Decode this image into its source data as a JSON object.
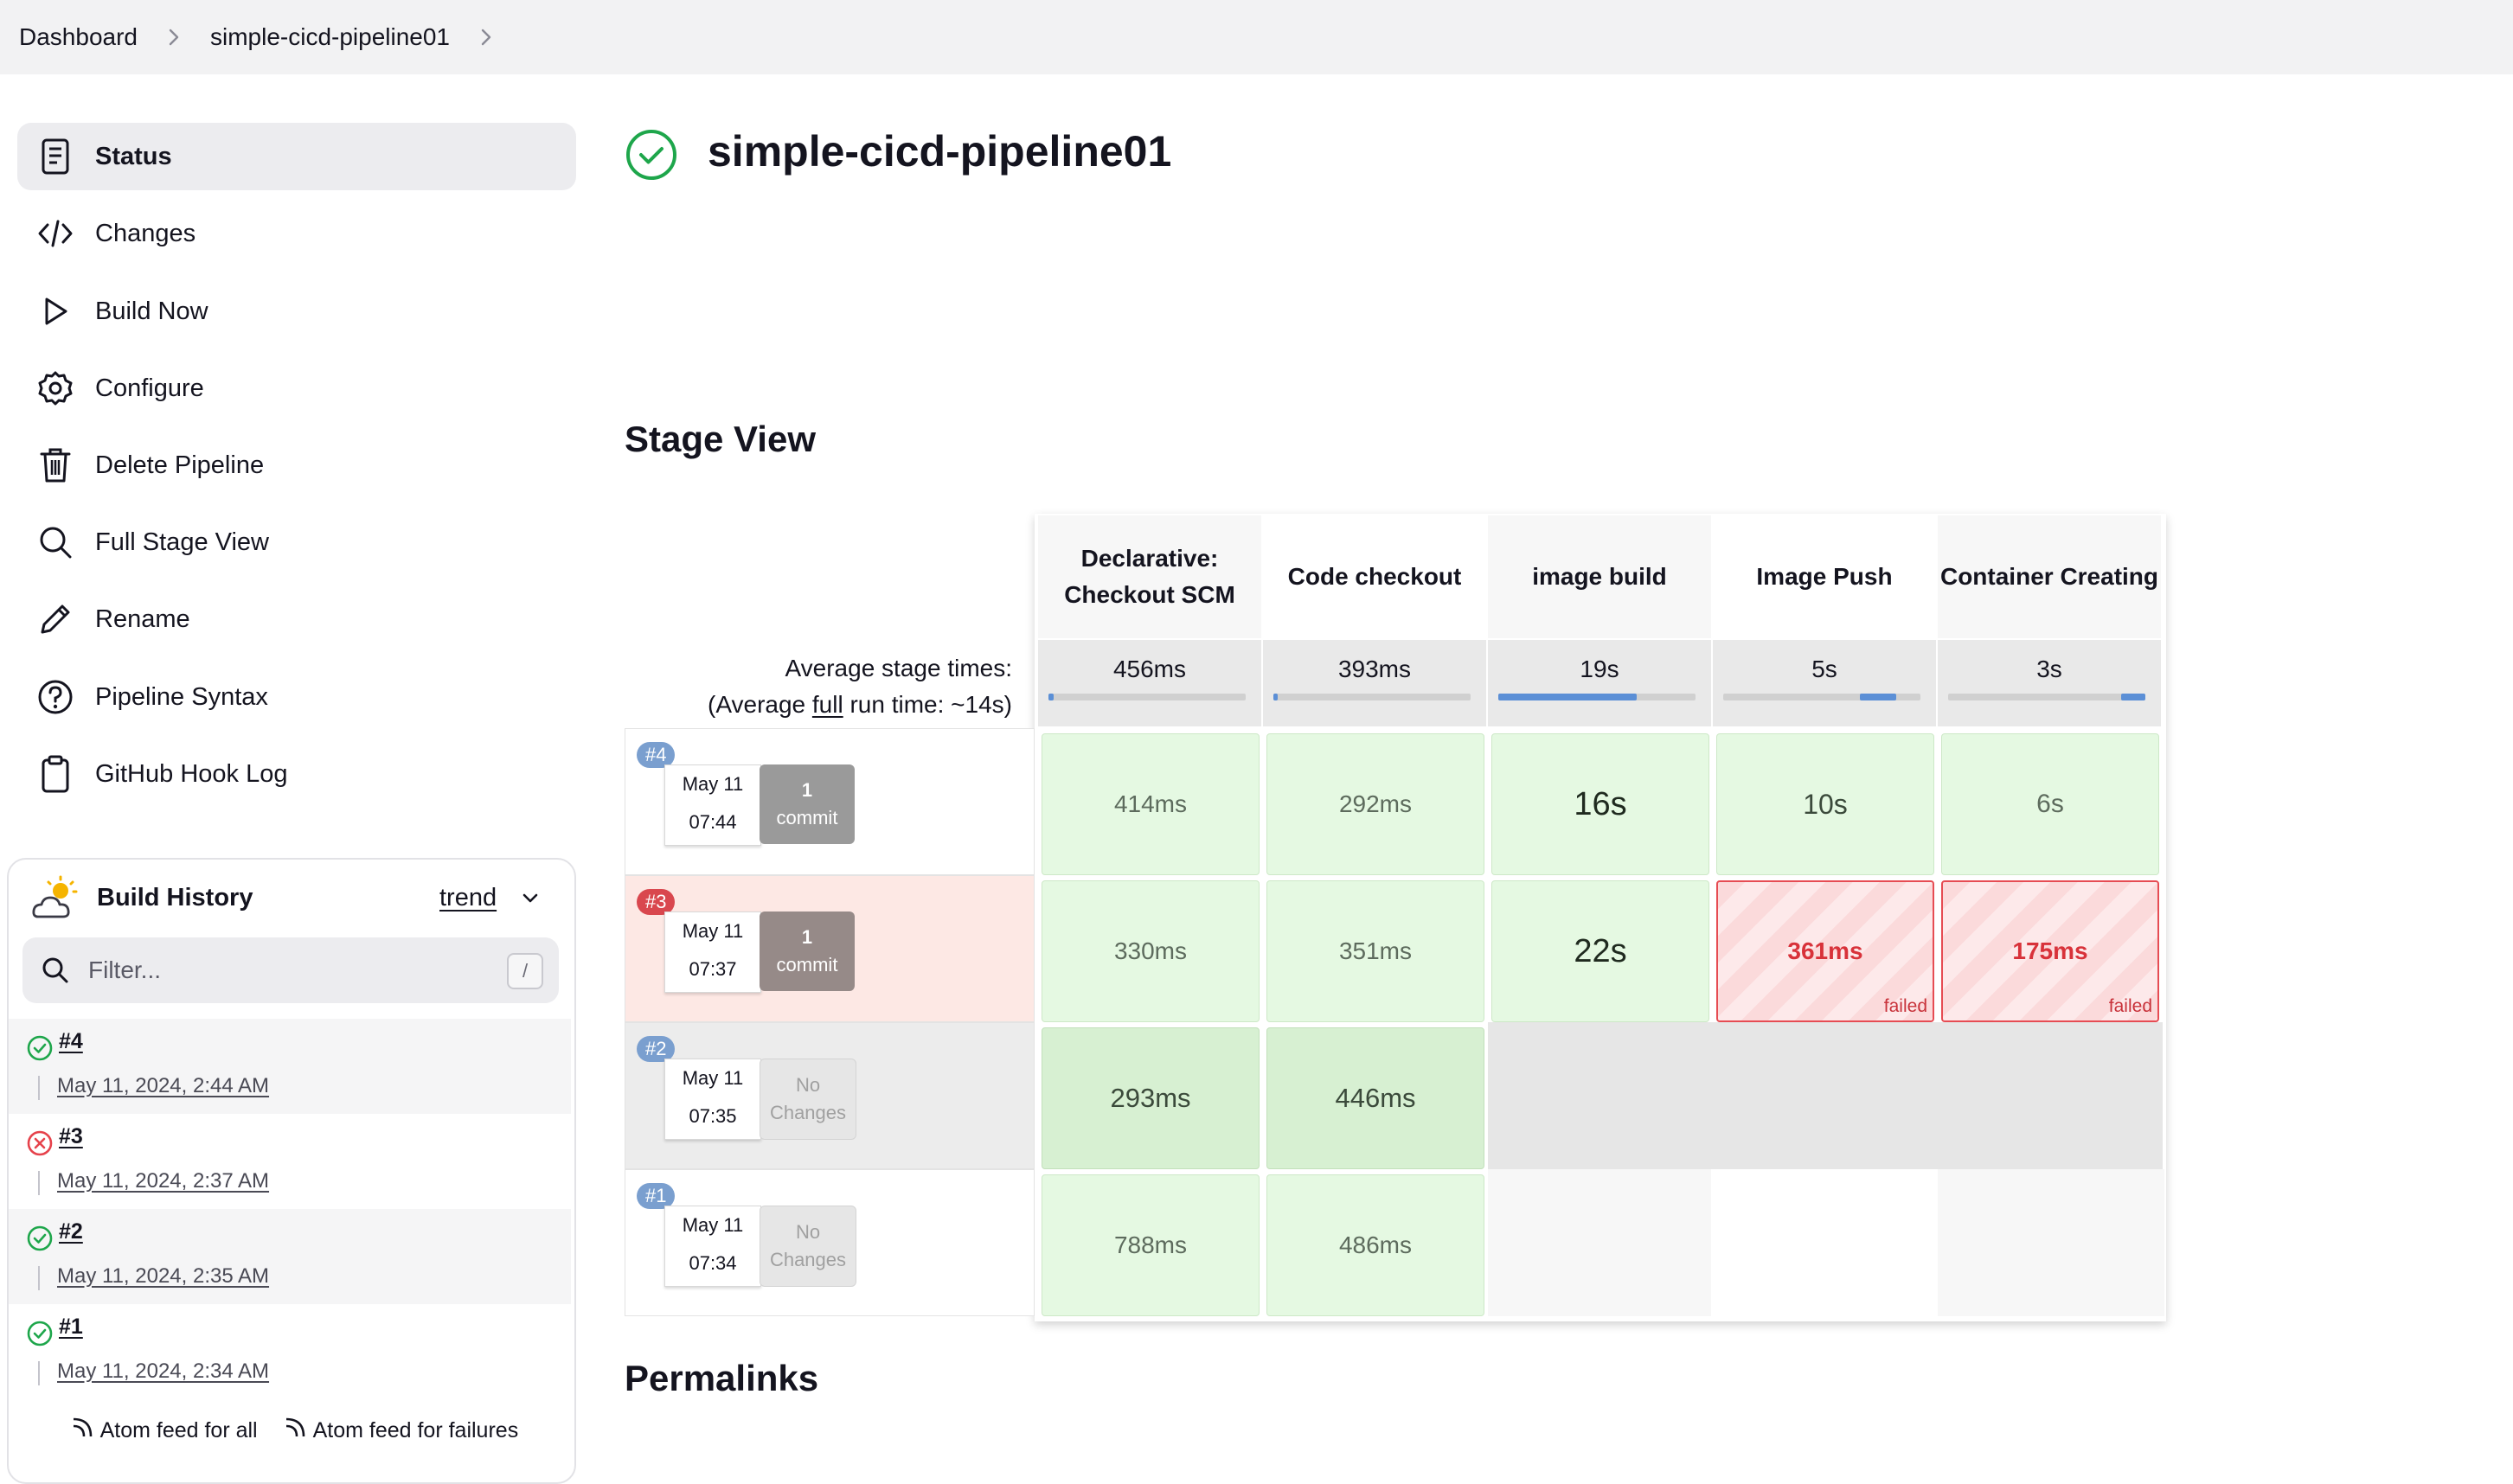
{
  "breadcrumb": [
    "Dashboard",
    "simple-cicd-pipeline01"
  ],
  "sidebar": {
    "items": [
      {
        "label": "Status",
        "icon": "status-doc-icon",
        "active": true
      },
      {
        "label": "Changes",
        "icon": "code-icon"
      },
      {
        "label": "Build Now",
        "icon": "play-icon"
      },
      {
        "label": "Configure",
        "icon": "gear-icon"
      },
      {
        "label": "Delete Pipeline",
        "icon": "trash-icon"
      },
      {
        "label": "Full Stage View",
        "icon": "search-icon"
      },
      {
        "label": "Rename",
        "icon": "pencil-icon"
      },
      {
        "label": "Pipeline Syntax",
        "icon": "help-icon"
      },
      {
        "label": "GitHub Hook Log",
        "icon": "clipboard-icon"
      }
    ]
  },
  "build_history": {
    "title": "Build History",
    "trend_label": "trend",
    "filter_placeholder": "Filter...",
    "shortcut_key": "/",
    "builds": [
      {
        "number": "#4",
        "status": "success",
        "date": "May 11, 2024, 2:44 AM"
      },
      {
        "number": "#3",
        "status": "failed",
        "date": "May 11, 2024, 2:37 AM"
      },
      {
        "number": "#2",
        "status": "success",
        "date": "May 11, 2024, 2:35 AM"
      },
      {
        "number": "#1",
        "status": "success",
        "date": "May 11, 2024, 2:34 AM"
      }
    ],
    "atom_all": "Atom feed for all",
    "atom_failures": "Atom feed for failures"
  },
  "main": {
    "title": "simple-cicd-pipeline01",
    "status": "success",
    "stage_view_title": "Stage View",
    "permalinks_title": "Permalinks"
  },
  "stage_view": {
    "stages": [
      {
        "name": "Declarative: Checkout SCM",
        "avg": "456ms"
      },
      {
        "name": "Code checkout",
        "avg": "393ms"
      },
      {
        "name": "image build",
        "avg": "19s"
      },
      {
        "name": "Image Push",
        "avg": "5s"
      },
      {
        "name": "Container Creating",
        "avg": "3s"
      }
    ],
    "avg_stage_label": "Average stage times:",
    "avg_full_prefix": "(Average ",
    "avg_full_link": "full",
    "avg_full_suffix": " run time: ~14s)",
    "runs": [
      {
        "badge": "#4",
        "date": "May 11",
        "time": "07:44",
        "changes_line1": "1",
        "changes_line2": "commit",
        "times": [
          "414ms",
          "292ms",
          "16s",
          "10s",
          "6s"
        ]
      },
      {
        "badge": "#3",
        "date": "May 11",
        "time": "07:37",
        "changes_line1": "1",
        "changes_line2": "commit",
        "times": [
          "330ms",
          "351ms",
          "22s",
          "361ms",
          "175ms"
        ],
        "failed_label": "failed"
      },
      {
        "badge": "#2",
        "date": "May 11",
        "time": "07:35",
        "changes_line1": "No",
        "changes_line2": "Changes",
        "times": [
          "293ms",
          "446ms"
        ]
      },
      {
        "badge": "#1",
        "date": "May 11",
        "time": "07:34",
        "changes_line1": "No",
        "changes_line2": "Changes",
        "times": [
          "788ms",
          "486ms"
        ]
      }
    ]
  },
  "colors": {
    "success": "#1ea64b",
    "failure": "#e6424b",
    "badge_blue": "#7a9fcf",
    "badge_red": "#d9474e",
    "progress_blue": "#5b8fd6"
  }
}
